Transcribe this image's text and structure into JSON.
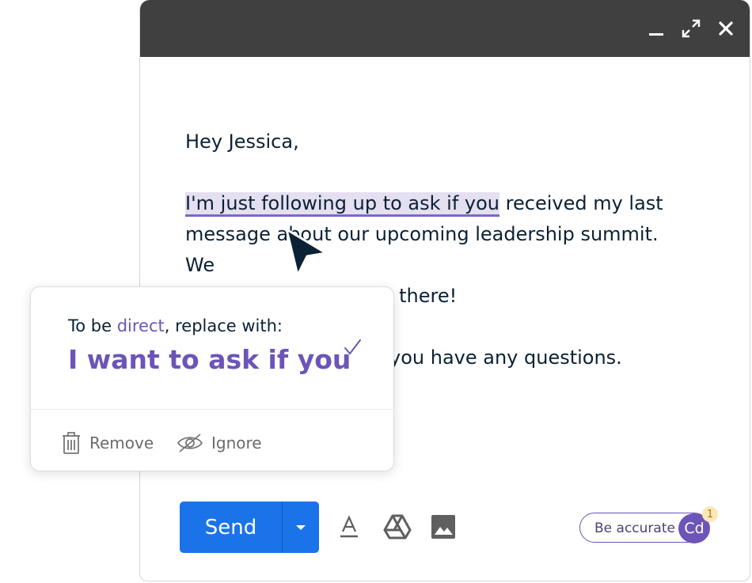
{
  "email": {
    "greeting": "Hey Jessica,",
    "highlighted_phrase": "I'm just following up to ask if you",
    "para1_rest_line1": " received my last",
    "para1_line2": "message about our upcoming leadership summit. We",
    "para1_line3": "would love to see you there!",
    "para2_visible": "you have any questions."
  },
  "suggestion": {
    "intro_prefix": "To be ",
    "intro_keyword": "direct",
    "intro_suffix": ", replace with:",
    "replacement": "I want to ask if you",
    "remove_label": "Remove",
    "ignore_label": "Ignore"
  },
  "toolbar": {
    "send_label": "Send"
  },
  "assistant": {
    "goal_label": "Be accurate",
    "avatar_initials": "Cd",
    "badge_count": "1"
  },
  "colors": {
    "titlebar": "#404040",
    "send": "#1a73e8",
    "accent": "#6c54b8",
    "highlight": "#e4dff1"
  },
  "icons": [
    "minimize-icon",
    "expand-icon",
    "close-icon",
    "check-icon",
    "trash-icon",
    "eye-off-icon",
    "chevron-down-icon",
    "text-format-icon",
    "drive-icon",
    "photo-icon",
    "cursor-icon"
  ]
}
